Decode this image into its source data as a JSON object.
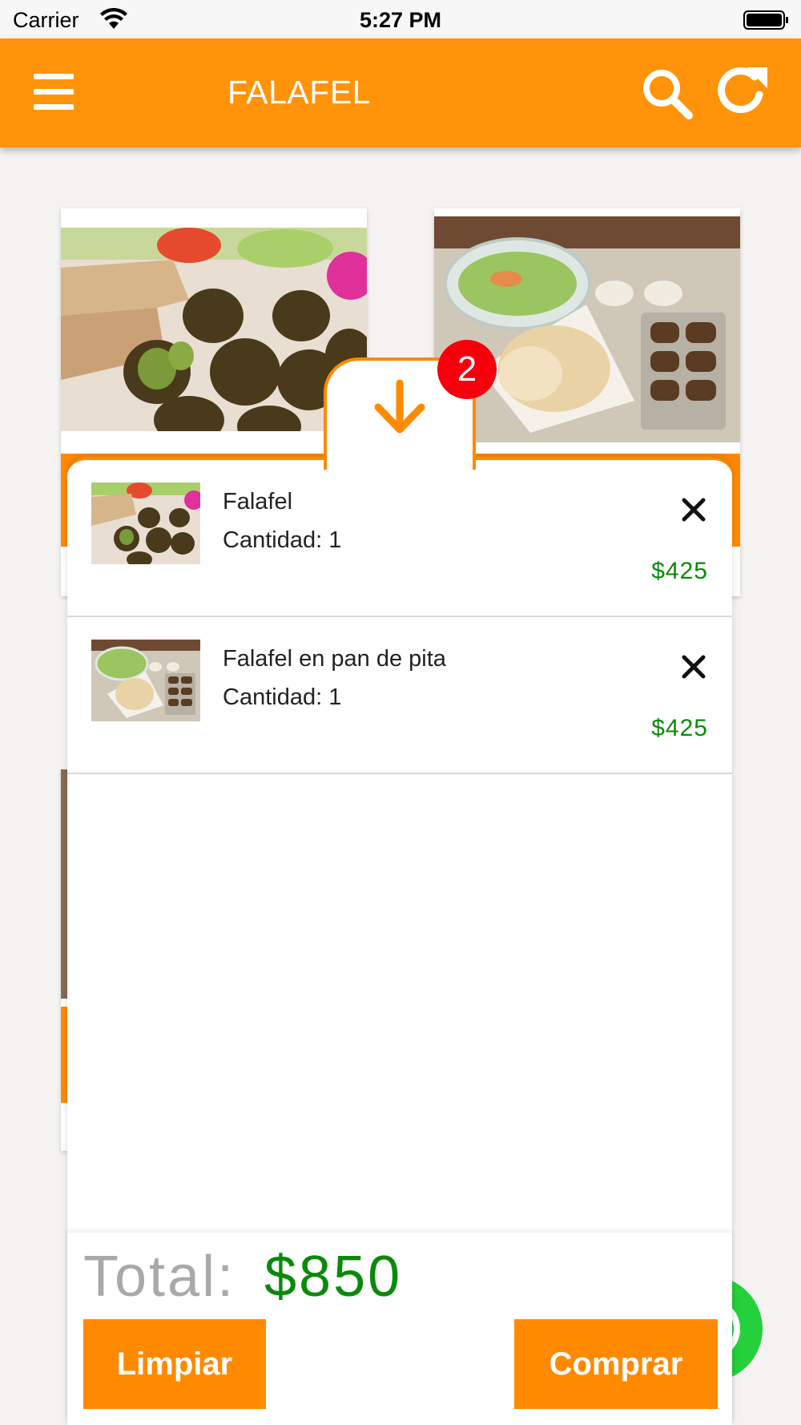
{
  "status_bar": {
    "carrier": "Carrier",
    "time": "5:27 PM"
  },
  "app_bar": {
    "title": "FALAFEL",
    "background_color": "#ff9309"
  },
  "cart": {
    "badge_count": "2",
    "items": [
      {
        "name": "Falafel",
        "quantity": "Cantidad: 1",
        "price": "$425",
        "thumbnail": "falafel-balls-photo"
      },
      {
        "name": "Falafel en pan de pita",
        "quantity": "Cantidad: 1",
        "price": "$425",
        "thumbnail": "falafel-pita-combo-photo"
      }
    ],
    "total_label": "Total:",
    "total_value": "$850",
    "clear_button": "Limpiar",
    "buy_button": "Comprar"
  },
  "colors": {
    "accent": "#ff8a00",
    "price": "#0a8a0a",
    "badge": "#f5000c",
    "whatsapp": "#25d13a"
  },
  "icons": [
    "menu-icon",
    "search-icon",
    "refresh-icon",
    "arrow-down-icon",
    "close-icon",
    "whatsapp-icon",
    "wifi-icon",
    "battery-icon"
  ]
}
